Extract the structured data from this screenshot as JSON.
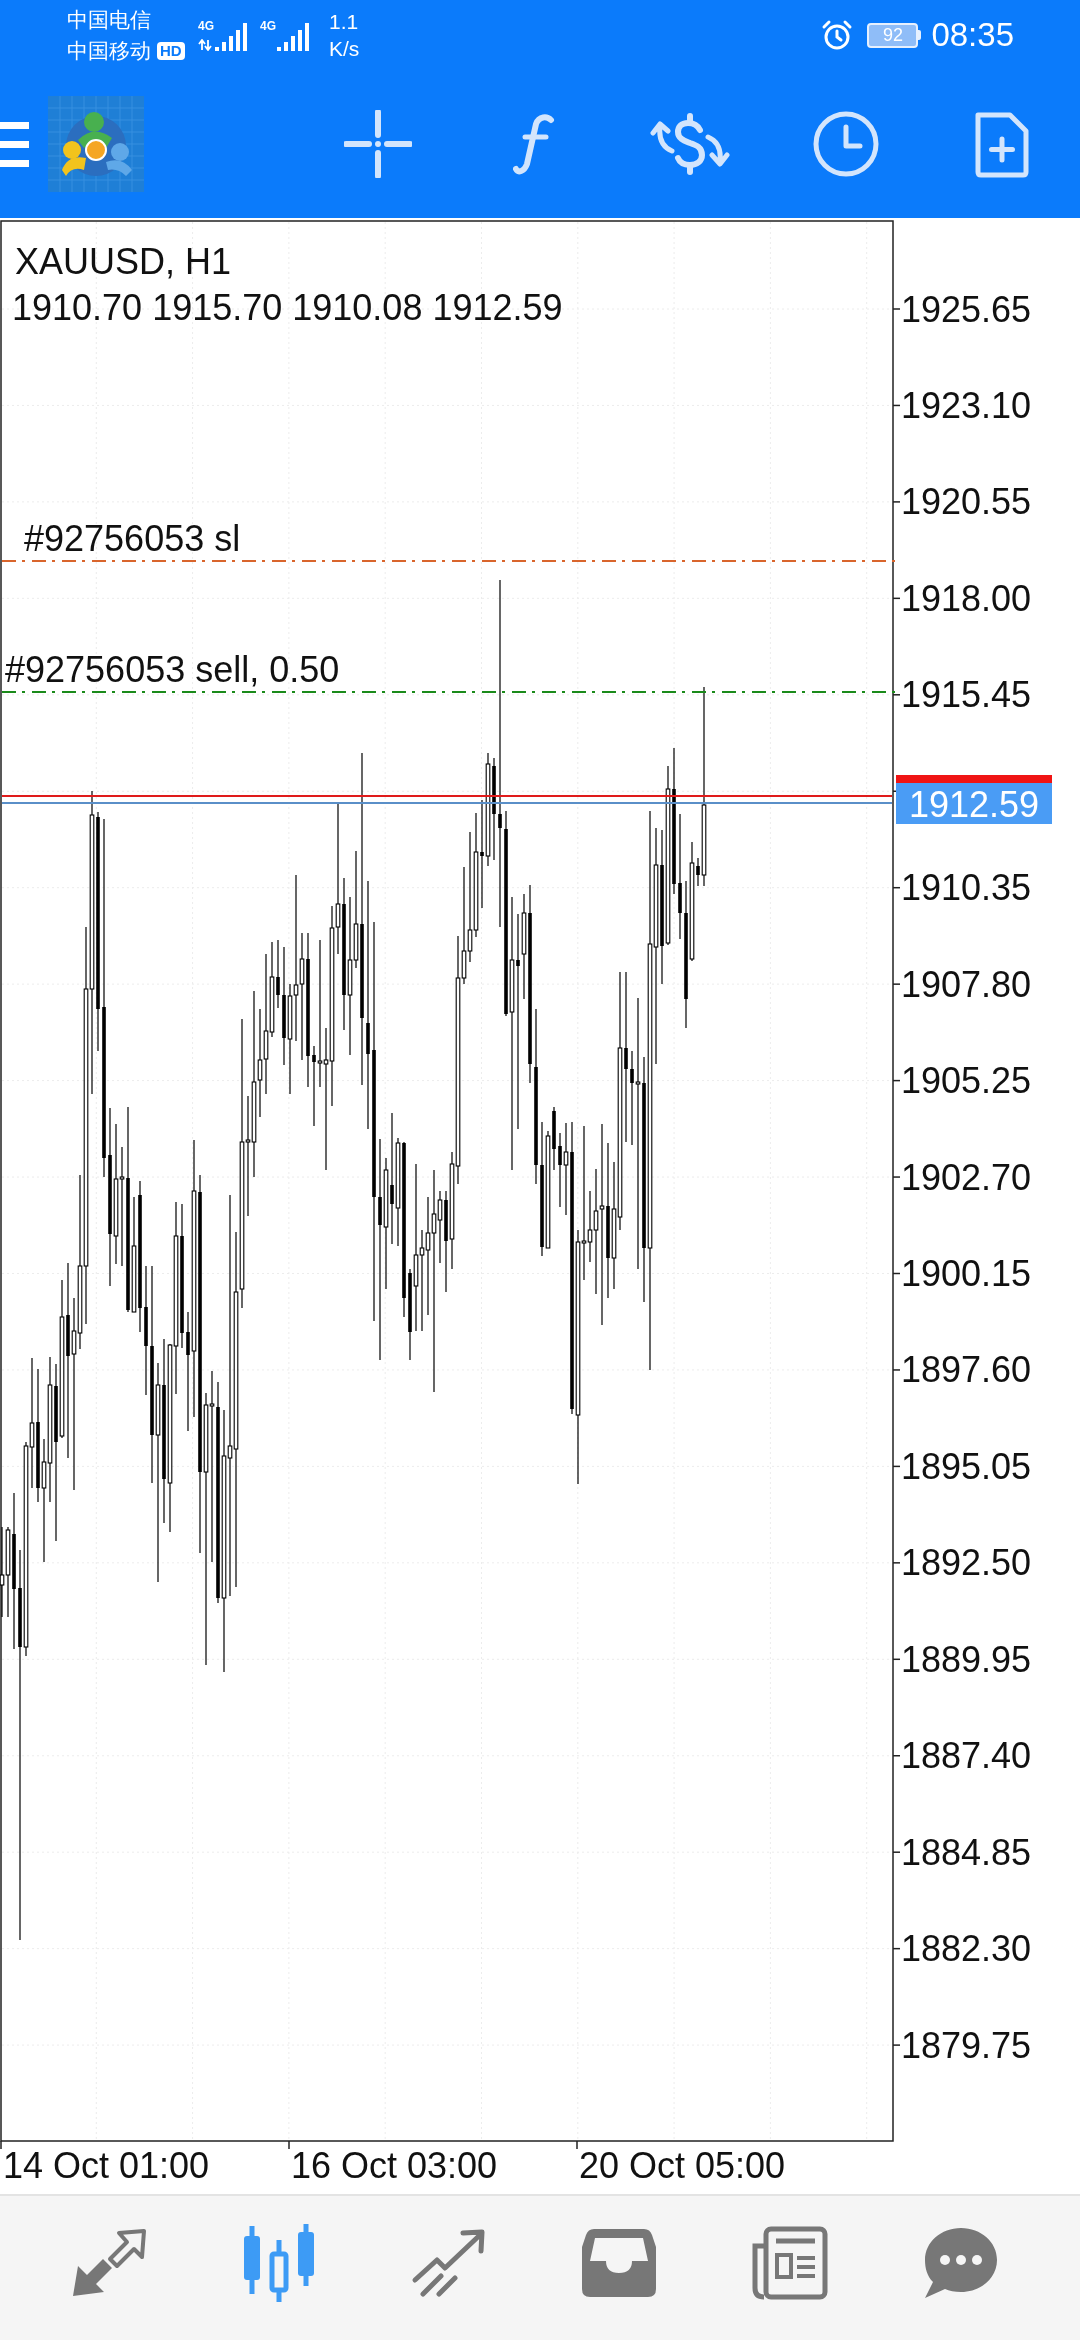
{
  "status_bar": {
    "carriers": [
      {
        "name": "中国电信"
      },
      {
        "name": "中国移动",
        "badge": "HD"
      }
    ],
    "signals": [
      {
        "network": "4G",
        "data_active": true
      },
      {
        "network": "4G",
        "data_active": false
      }
    ],
    "network_speed": {
      "value": "1.1",
      "unit": "K/s"
    },
    "battery": "92",
    "time": "08:35"
  },
  "chart": {
    "symbol": "XAUUSD, H1",
    "ohlc": "1910.70 1915.70 1910.08 1912.59",
    "order_lines": [
      {
        "label": "#92756053 sl",
        "color": "#d9652c"
      },
      {
        "label": "#92756053 sell, 0.50",
        "color": "#1a8a1a"
      }
    ],
    "price_scale": {
      "ticks_above_price": [
        "1925.65",
        "1923.10",
        "1920.55",
        "1918.00",
        "1915.45"
      ],
      "current_price": "1912.59",
      "ticks_below_price": [
        "1910.35",
        "1907.80",
        "1905.25",
        "1902.70",
        "1900.15",
        "1897.60",
        "1895.05",
        "1892.50",
        "1889.95",
        "1887.40",
        "1884.85",
        "1882.30",
        "1879.75"
      ]
    },
    "time_axis": [
      "14 Oct 01:00",
      "16 Oct 03:00",
      "20 Oct 05:00"
    ]
  },
  "bottom_nav": [
    {
      "selected": false
    },
    {
      "selected": true
    },
    {
      "selected": false
    },
    {
      "selected": false
    },
    {
      "selected": false
    },
    {
      "selected": false
    }
  ]
}
